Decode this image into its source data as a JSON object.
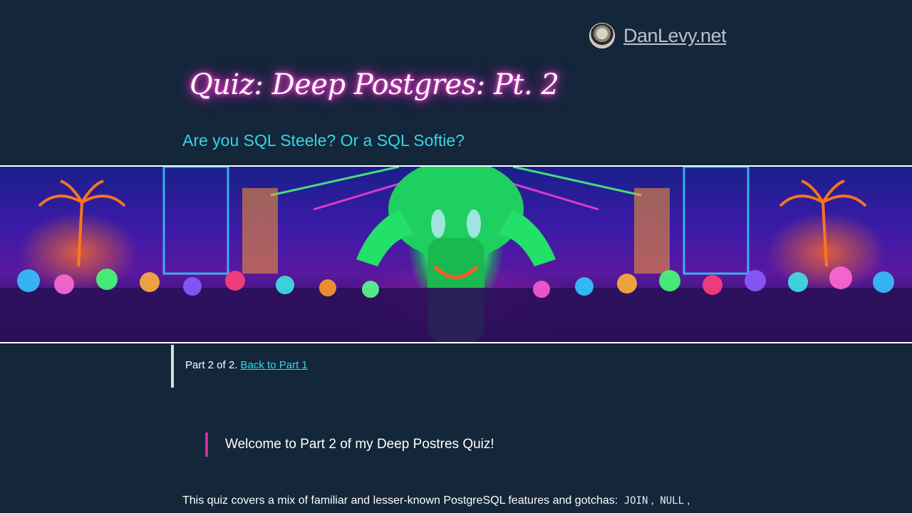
{
  "header": {
    "site_name": "DanLevy.net",
    "avatar_icon": "author-avatar-icon"
  },
  "article": {
    "title": "Quiz: Deep Postgres: Pt. 2",
    "subtitle": "Are you SQL Steele? Or a SQL Softie?"
  },
  "hero": {
    "icon": "neon-elephant-dance-party-illustration"
  },
  "callout": {
    "text": "Part 2 of 2. ",
    "link_label": "Back to Part 1"
  },
  "welcome": {
    "text": "Welcome to Part 2 of my Deep Postres Quiz!"
  },
  "intro": {
    "text": "This quiz covers a mix of familiar and lesser-known PostgreSQL features and gotchas: ",
    "code_1": "JOIN",
    "sep_1": ", ",
    "code_2": "NULL",
    "sep_2": ","
  },
  "colors": {
    "background": "#13263a",
    "accent_cyan": "#35d6e8",
    "accent_pink": "#e0249f",
    "title_glow": "#ff2fd0"
  }
}
